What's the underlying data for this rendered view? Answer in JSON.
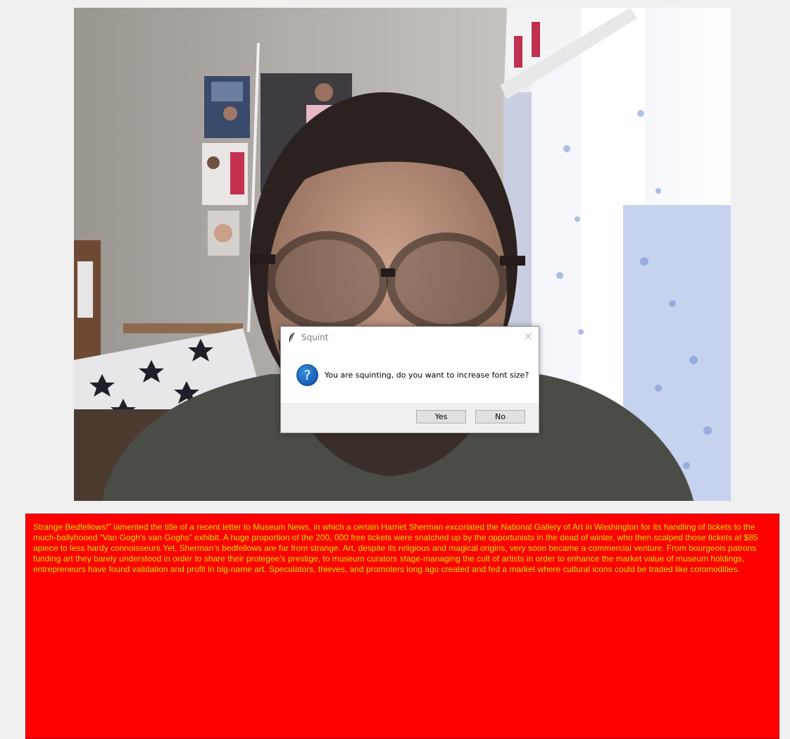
{
  "dialog": {
    "title": "Squint",
    "close_glyph": "✕",
    "message": "You are squinting, do you want to increase font size?",
    "yes_label": "Yes",
    "no_label": "No",
    "icon": "question-icon",
    "app_icon": "feather-icon"
  },
  "text_panel": {
    "text": "Strange Bedfellows!” lamented the title of a recent letter to Museum News, in which a certain Harriet Sherman excoriated the National Gallery of Art in Washington for its handling of tickets to the much-ballyhooed “Van Gogh’s van Goghs” exhibit. A huge proportion of the 200, 000 free tickets were snatched up by the opportunists in the dead of winter, who then scalped those tickets at $85 apiece to less hardy connoisseurs.Yet, Sherman’s bedfellows are far from strange. Art, despite its religious and magical origins, very soon became a commercial venture. From bourgeois patrons funding art they barely understood in order to share their protegee’s prestige, to museum curators stage-managing the cult of artists in order to enhance the market value of museum holdings, entrepreneurs have found validation and profit in big-name art. Speculators, thieves, and promoters long ago created and fed a market where cultural icons could be traded like commodities.",
    "background": "#ff0000",
    "text_color": "#c8e000"
  },
  "webcam": {
    "description_icon": "webcam-feed"
  }
}
